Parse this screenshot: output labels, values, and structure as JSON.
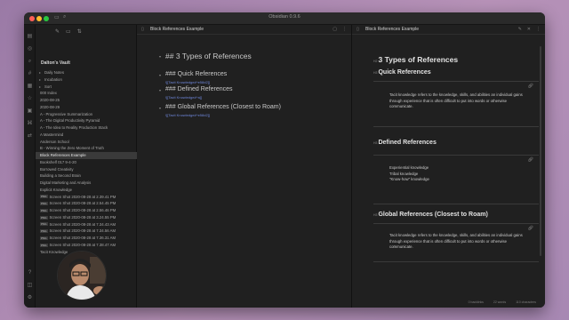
{
  "app": {
    "window_title": "Obsidian 0.9.6",
    "vault_name": "Dalton's Vault"
  },
  "sidebar": {
    "items": [
      {
        "label": "Daily Notes",
        "type": "folder"
      },
      {
        "label": "Incubation",
        "type": "folder"
      },
      {
        "label": "Sort",
        "type": "folder"
      },
      {
        "label": "000 Index",
        "type": "file"
      },
      {
        "label": "2020-08-25",
        "type": "file"
      },
      {
        "label": "2020-08-29",
        "type": "file"
      },
      {
        "label": "A - Progressive Summarization",
        "type": "file"
      },
      {
        "label": "A - The Digital Productivity Pyramid",
        "type": "file"
      },
      {
        "label": "A - The Idea to Reality Production Stack",
        "type": "file"
      },
      {
        "label": "A Mastermind",
        "type": "file"
      },
      {
        "label": "Anderson School",
        "type": "file"
      },
      {
        "label": "B - Winning the Zero Moment of Truth",
        "type": "file"
      },
      {
        "label": "Block References Example",
        "type": "file",
        "active": true
      },
      {
        "label": "Bookshelf 017 9-4-20",
        "type": "file"
      },
      {
        "label": "Borrowed Creativity",
        "type": "file"
      },
      {
        "label": "Building a Second Brain",
        "type": "file"
      },
      {
        "label": "Digital Marketing and Analysis",
        "type": "file"
      },
      {
        "label": "Explicit Knowledge",
        "type": "file"
      },
      {
        "label": "Screen Shot 2020-08-28 at 2.39.41 PM",
        "type": "png"
      },
      {
        "label": "Screen Shot 2020-08-28 at 2.54.45 PM",
        "type": "png"
      },
      {
        "label": "Screen Shot 2020-08-28 at 2.56.46 PM",
        "type": "png"
      },
      {
        "label": "Screen Shot 2020-08-28 at 3.24.55 PM",
        "type": "png"
      },
      {
        "label": "Screen Shot 2020-08-28 at 7.34.43 AM",
        "type": "png"
      },
      {
        "label": "Screen Shot 2020-08-28 at 7.34.56 AM",
        "type": "png"
      },
      {
        "label": "Screen Shot 2020-08-28 at 7.36.31 AM",
        "type": "png"
      },
      {
        "label": "Screen Shot 2020-08-28 at 7.38.47 AM",
        "type": "png"
      },
      {
        "label": "Tacit Knowledge",
        "type": "file"
      }
    ],
    "png_badge": "PNG"
  },
  "editor": {
    "title": "Block References Example",
    "lines": {
      "h2": "## 3 Types of References",
      "h3_quick": "### Quick References",
      "link_quick": "![[Tacit Knowledge#^e58d2]]",
      "h3_defined": "### Defined References",
      "link_defined": "![[Tacit Knowledge#^a]]",
      "h3_global": "### Global References (Closest to Roam)",
      "link_global": "![[Tacit Knowledge#^e58d2]]"
    }
  },
  "preview": {
    "title": "Block References Example",
    "h2": "3 Types of References",
    "h2_tag": "H2",
    "h3_tag": "H3",
    "quick": {
      "heading": "Quick References",
      "text": "Tacit knowledge refers to the knowledge, skills, and abilities an individual gains through experience that is often difficult to put into words or otherwise communicate."
    },
    "defined": {
      "heading": "Defined References",
      "lines": [
        "Experiential knowledge",
        "Tribal knowledge",
        "\"Know-how\" knowledge"
      ]
    },
    "global": {
      "heading": "Global References (Closest to Roam)",
      "text": "Tacit knowledge refers to the knowledge, skills, and abilities an individual gains through experience that is often difficult to put into words or otherwise communicate."
    }
  },
  "status": {
    "backlinks": "0 backlinks",
    "words": "22 words",
    "characters": "110 characters"
  },
  "icons": {
    "link": "link-icon",
    "edit": "edit-icon",
    "close": "close-icon"
  }
}
